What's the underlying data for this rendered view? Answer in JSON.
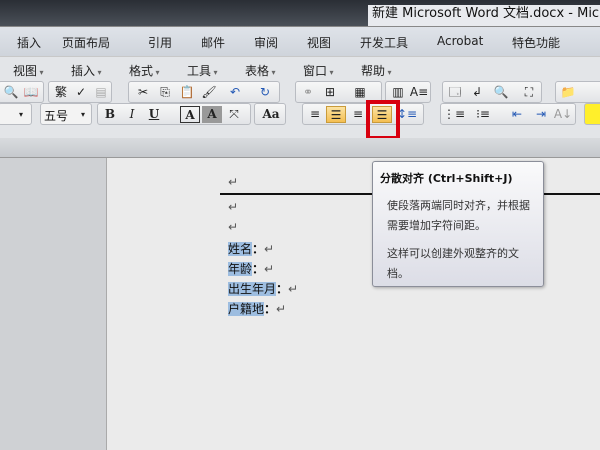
{
  "window": {
    "title": "新建 Microsoft Word 文档.docx - Micros"
  },
  "ribbon_tabs": [
    "插入",
    "页面布局",
    "引用",
    "邮件",
    "审阅",
    "视图",
    "开发工具",
    "Acrobat",
    "特色功能"
  ],
  "menus": [
    "视图",
    "插入",
    "格式",
    "工具",
    "表格",
    "窗口",
    "帮助"
  ],
  "font_size": "五号",
  "format_buttons": {
    "bold": "B",
    "italic": "I",
    "underline": "U",
    "char_border": "A",
    "char_shading": "A",
    "change_case": "Aa"
  },
  "document": {
    "lines": [
      "姓名",
      "年龄",
      "出生年月",
      "户籍地"
    ],
    "colon": "：",
    "para_mark": "↵"
  },
  "tooltip": {
    "title": "分散对齐 (Ctrl+Shift+J)",
    "desc1": "使段落两端同时对齐，并根据需要增加字符间距。",
    "desc2": "这样可以创建外观整齐的文档。"
  },
  "colors": {
    "highlight": "#d8000f",
    "selection": "#9dbde0"
  }
}
